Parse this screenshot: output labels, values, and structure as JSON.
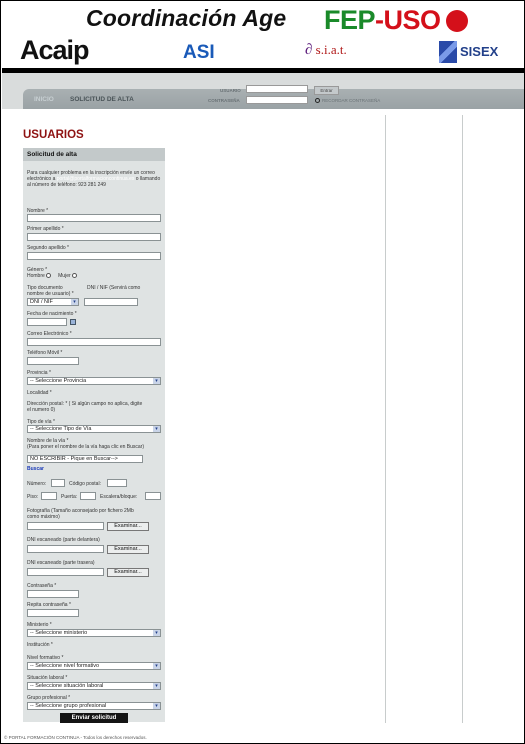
{
  "header": {
    "title": "Coordinación Age",
    "logos": {
      "fep": "FEP-USO",
      "acaip": "Acaip",
      "asi": "ASI",
      "siat": "s.i.a.t.",
      "sisex": "SISEX"
    }
  },
  "nav": {
    "items": [
      "INICIO",
      "SOLICITUD DE ALTA"
    ],
    "login": {
      "user_label": "USUARIO",
      "password_label": "CONTRASEÑA",
      "enter_label": "Entrar",
      "remember_label": "RECORDAR CONTRASEÑA"
    }
  },
  "page": {
    "title": "USUARIOS"
  },
  "form": {
    "heading": "Solicitud de alta",
    "intro_before": "Para cualquier problema en la inscripción envíe un correo electrónico a ",
    "intro_email": "portal@portalformacioncontinua.es",
    "intro_after": " o llamando al número de teléfono: 923 281 249",
    "labels": {
      "nombre": "Nombre *",
      "apellido1": "Primer apellido *",
      "apellido2": "Segundo apellido *",
      "genero": "Género *",
      "hombre": "Hombre",
      "mujer": "Mujer",
      "tipo_doc": "Tipo documento",
      "tipo_doc_extra": "DNI / NIF (Servirá como",
      "tipo_doc_extra2": "nombre de usuario) *",
      "fecha": "Fecha de nacimiento *",
      "correo": "Correo Electrónico *",
      "telefono": "Teléfono Móvil *",
      "provincia": "Provincia *",
      "localidad": "Localidad *",
      "direccion": "Dirección postal: *  ( Si algún campo no aplica, digite",
      "direccion2": "el numero 0)",
      "tipo_via": "Tipo de vía *",
      "nombre_via": "Nombre de la vía *",
      "nombre_via_hint": "(Para poner el nombre de la vía haga clic en Buscar)",
      "buscar": "Buscar",
      "numero": "Número:",
      "codigo_postal": "Código postal:",
      "piso": "Piso:",
      "puerta": "Puerta:",
      "escalera": "Escalera/bloque:",
      "fotografia": "Fotografía  (Tamaño aconsejado por fichero 2Mb",
      "fotografia2": "como máximo)",
      "dni_delante": "DNI escaneado (parte delantera)",
      "dni_trasera": "DNI escaneado (parte trasera)",
      "contrasena": "Contraseña *",
      "repita": "Repita contraseña *",
      "ministerio": "Ministerio *",
      "institucion": "Institución *",
      "nivel": "Nivel formativo *",
      "situacion": "Situación laboral *",
      "grupo": "Grupo profesional *"
    },
    "selects": {
      "tipo_doc": "DNI / NIF",
      "provincia": "-- Seleccione Provincia",
      "tipo_via": "-- Seleccione Tipo de Vía",
      "ministerio": "-- Seleccione ministerio",
      "nivel": "-- Seleccione nivel formativo",
      "situacion": "-- Seleccione situación laboral",
      "grupo": "-- Seleccione grupo profesional"
    },
    "via_placeholder": "NO ESCRIBIR - Pique en Buscar-->",
    "examinar": "Examinar...",
    "submit": "Enviar solicitud"
  },
  "footer": "© PORTAL FORMACIÓN CONTINUA - Todos los derechos reservados."
}
